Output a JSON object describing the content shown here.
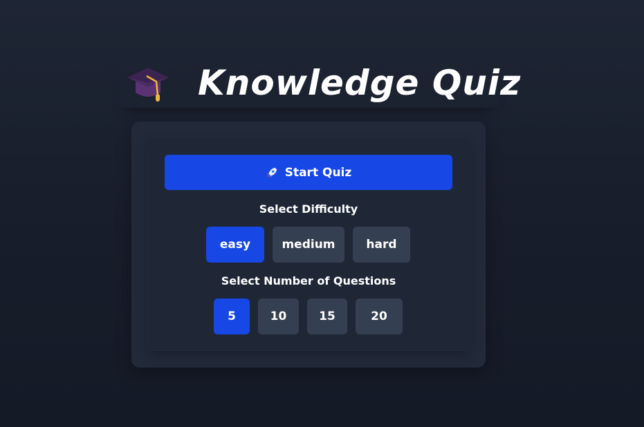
{
  "header": {
    "icon": "graduation-cap-icon",
    "title": "Knowledge Quiz"
  },
  "quiz": {
    "start_button": {
      "icon": "rocket-icon",
      "label": "Start Quiz"
    },
    "difficulty": {
      "label": "Select Difficulty",
      "options": [
        "easy",
        "medium",
        "hard"
      ],
      "selected": "easy"
    },
    "question_count": {
      "label": "Select Number of Questions",
      "options": [
        "5",
        "10",
        "15",
        "20"
      ],
      "selected": "5"
    }
  },
  "colors": {
    "accent": "#1748e6",
    "option_bg": "#353f52",
    "card_bg": "#222a3a",
    "page_bg": "#171d2a"
  }
}
